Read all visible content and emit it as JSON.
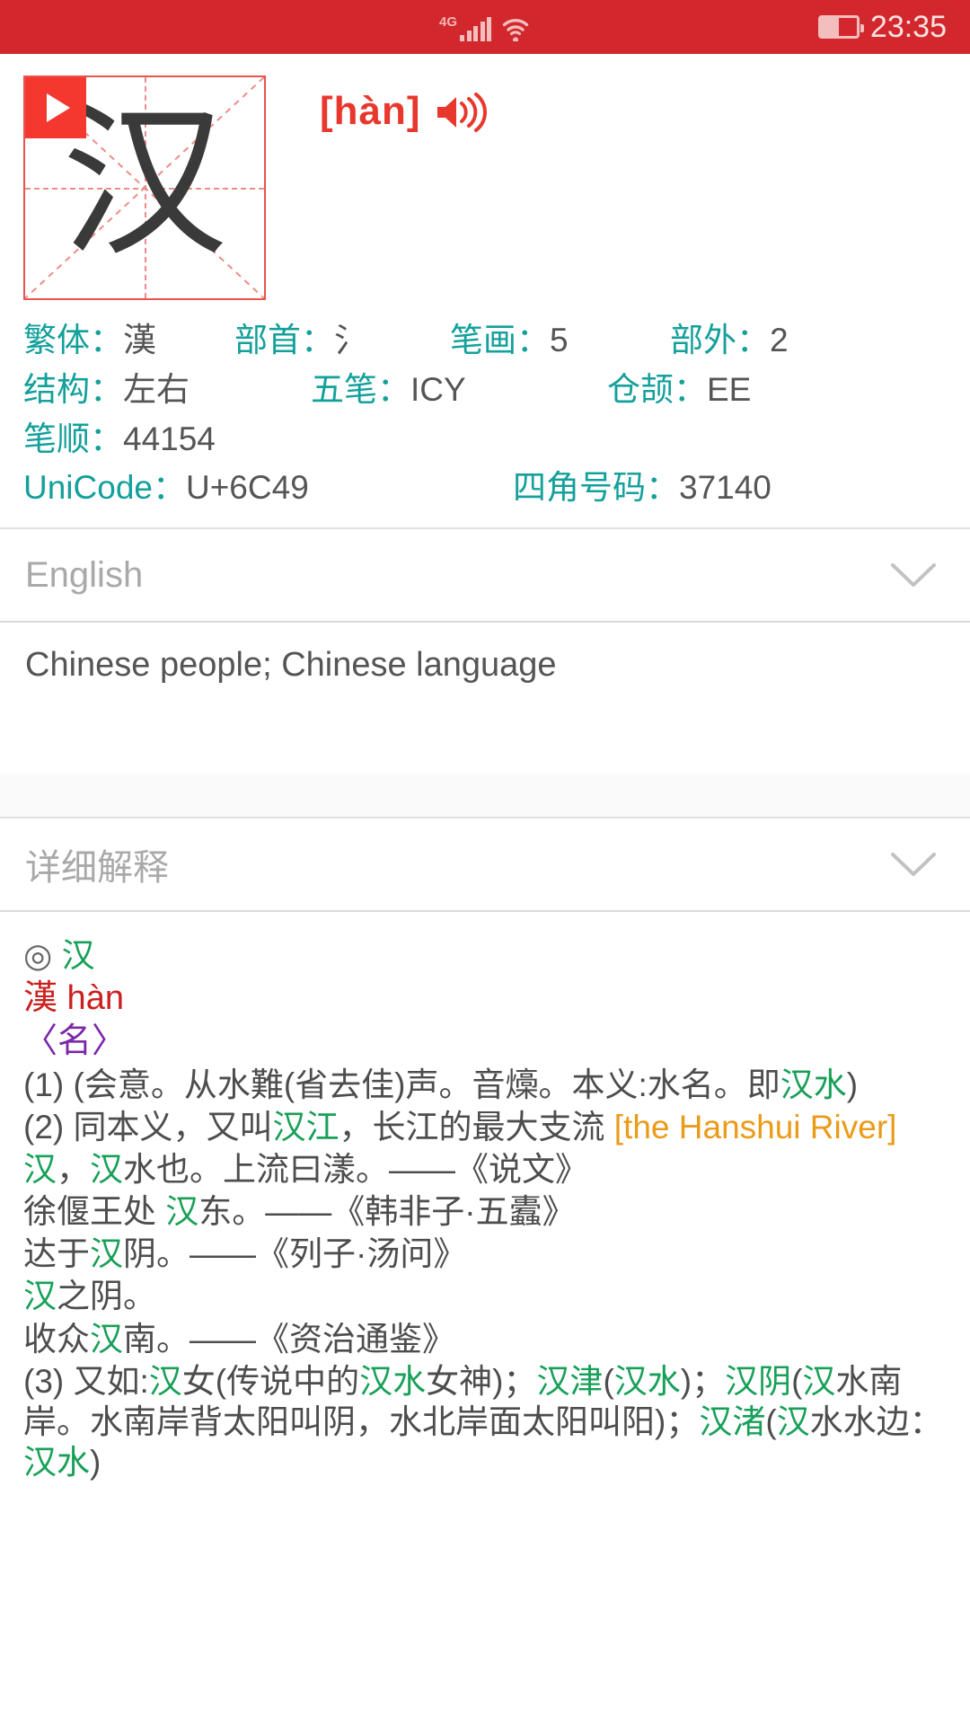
{
  "status_bar": {
    "network_label": "4G",
    "signal_icon": "signal-bars-icon",
    "wifi_icon": "wifi-icon",
    "battery_icon": "battery-icon",
    "time": "23:35"
  },
  "character": {
    "glyph": "汉",
    "play_icon": "play-icon",
    "pinyin": "[hàn]",
    "speaker_icon": "speaker-icon"
  },
  "info": {
    "traditional_label": "繁体：",
    "traditional_value": "漢",
    "radical_label": "部首：",
    "radical_value": "氵",
    "strokes_label": "笔画：",
    "strokes_value": "5",
    "outer_label": "部外：",
    "outer_value": "2",
    "structure_label": "结构：",
    "structure_value": "左右",
    "wubi_label": "五笔：",
    "wubi_value": "ICY",
    "cangjie_label": "仓颉：",
    "cangjie_value": "EE",
    "stroke_order_label": "笔顺：",
    "stroke_order_value": "44154",
    "unicode_label": "UniCode：",
    "unicode_value": "U+6C49",
    "fourcorner_label": "四角号码：",
    "fourcorner_value": "37140"
  },
  "english_section": {
    "title": "English",
    "chevron_icon": "chevron-down-icon",
    "content": "Chinese people; Chinese language"
  },
  "detail_section": {
    "title": "详细解释",
    "chevron_icon": "chevron-down-icon"
  },
  "detail": {
    "head_circle": "◎",
    "head_char": "汉",
    "traditional_pinyin": "漢 hàn",
    "part_of_speech": "〈名〉",
    "def1": {
      "num": "(1) ",
      "pre": "(会意。从水難(省去佳)声。音燺。本义:水名。即",
      "green": "汉水",
      "post": ")"
    },
    "def2": {
      "num": "(2) ",
      "pre": "同本义，又叫",
      "green": "汉江",
      "mid": "，长江的最大支流 ",
      "orange": "[the Hanshui River]"
    },
    "quote1": {
      "g1": "汉",
      "t1": "，",
      "g2": "汉",
      "t2": "水也。上流曰漾。——《说文》"
    },
    "quote2": {
      "t1": "徐偃王处 ",
      "g1": "汉",
      "t2": "东。——《韩非子·五蠹》"
    },
    "quote3": {
      "t1": "达于",
      "g1": "汉",
      "t2": "阴。——《列子·汤问》"
    },
    "quote4": {
      "g1": "汉",
      "t1": "之阴。"
    },
    "quote5": {
      "t1": "收众",
      "g1": "汉",
      "t2": "南。——《资治通鉴》"
    },
    "def3": {
      "num": "(3) ",
      "t1": "又如:",
      "g1": "汉",
      "t2": "女(传说中的",
      "g2": "汉水",
      "t3": "女神)；",
      "g3": "汉津",
      "t4": "(",
      "g4": "汉水",
      "t5": ")；",
      "g5": "汉阴",
      "t6": "(",
      "g6": "汉",
      "t7": "水南岸。水南岸背太阳叫阴，水北岸面太阳叫阳)；",
      "g7": "汉渚",
      "t8": "(",
      "g8": "汉",
      "t9": "水水边：",
      "g9": "汉水",
      "t10": ")"
    }
  },
  "colors": {
    "status_bar_red": "#d2282d",
    "accent_red": "#e8382d",
    "label_teal": "#14a09b",
    "highlight_green": "#18a058",
    "orange": "#eb9b18",
    "purple": "#7a27a8"
  }
}
